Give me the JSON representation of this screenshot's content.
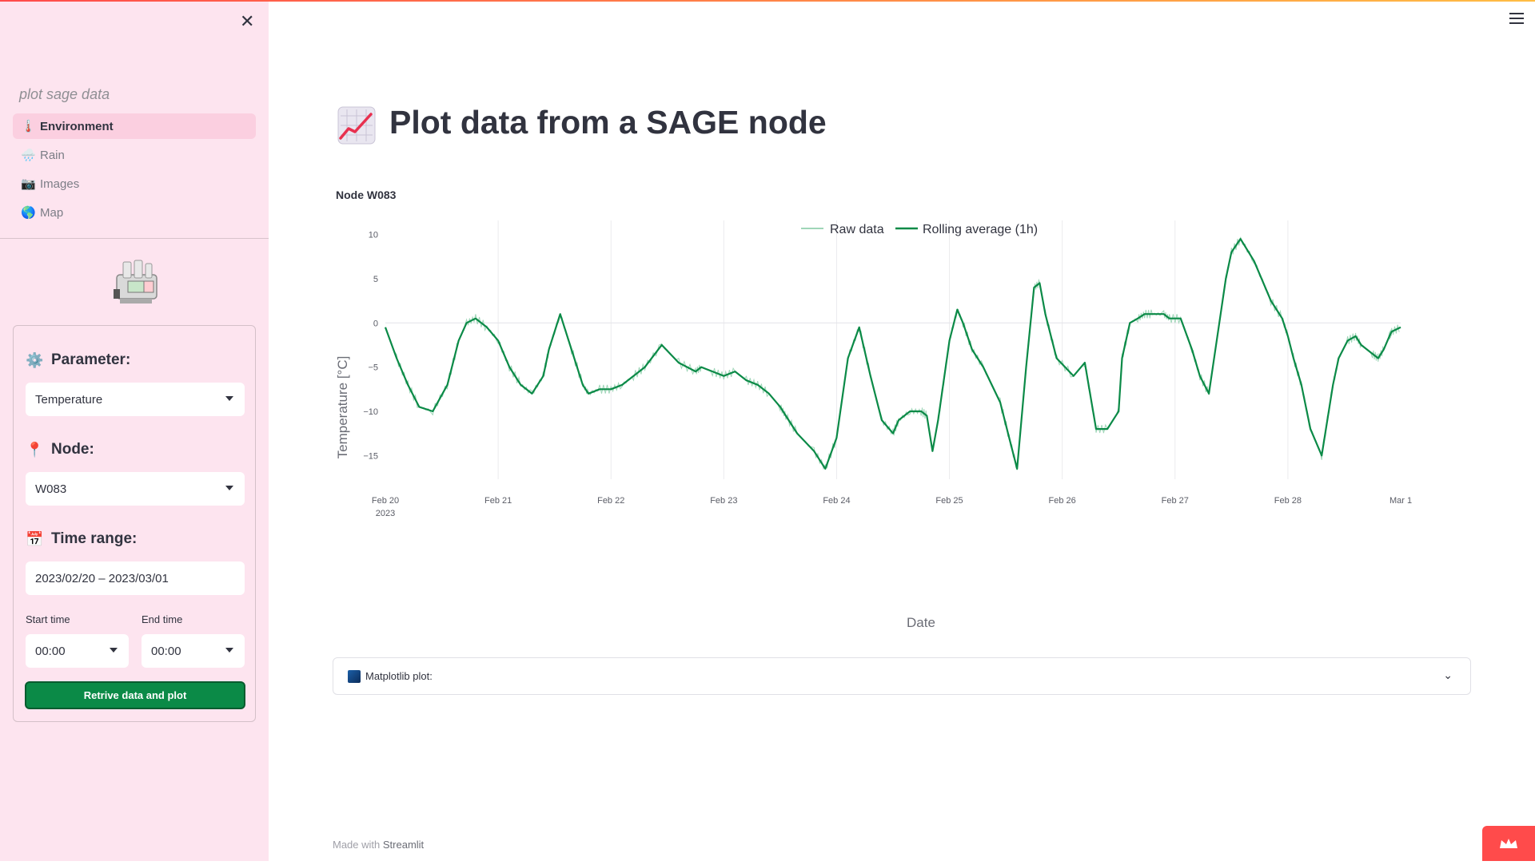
{
  "sidebar": {
    "app_name": "plot sage data",
    "nav": [
      {
        "label": "Environment",
        "icon": "thermometer-icon",
        "active": true
      },
      {
        "label": "Rain",
        "icon": "rain-cloud-icon",
        "active": false
      },
      {
        "label": "Images",
        "icon": "camera-icon",
        "active": false
      },
      {
        "label": "Map",
        "icon": "globe-icon",
        "active": false
      }
    ],
    "parameter": {
      "label": "Parameter:",
      "value": "Temperature"
    },
    "node": {
      "label": "Node:",
      "value": "W083"
    },
    "time_range": {
      "label": "Time range:",
      "value": "2023/02/20 – 2023/03/01"
    },
    "start_time": {
      "label": "Start time",
      "value": "00:00"
    },
    "end_time": {
      "label": "End time",
      "value": "00:00"
    },
    "button_label": "Retrive data and plot"
  },
  "main": {
    "title": "Plot data from a SAGE node",
    "subheader": "Node W083",
    "expander_label": "Matplotlib plot:"
  },
  "footer": {
    "prefix": "Made with",
    "brand": "Streamlit"
  },
  "colors": {
    "accent": "#0b8a47",
    "sidebar_bg": "#fde4ef",
    "raw_line": "#9fd6b8",
    "avg_line": "#0b8a47"
  },
  "chart_data": {
    "type": "line",
    "xlabel": "Date",
    "ylabel": "Temperature [°C]",
    "ylim": [
      -17.5,
      10.5
    ],
    "yticks": [
      10,
      5,
      0,
      -5,
      -10,
      -15
    ],
    "ytick_labels": [
      "10",
      "5",
      "0",
      "−5",
      "−10",
      "−15"
    ],
    "xticks": [
      0,
      1,
      2,
      3,
      4,
      5,
      6,
      7,
      8,
      9
    ],
    "xtick_labels": [
      "Feb 20",
      "Feb 21",
      "Feb 22",
      "Feb 23",
      "Feb 24",
      "Feb 25",
      "Feb 26",
      "Feb 27",
      "Feb 28",
      "Mar 1"
    ],
    "xtick_sublabel": "2023",
    "legend_position": "top-center",
    "grid": true,
    "series": [
      {
        "name": "Raw data",
        "color": "#9fd6b8"
      },
      {
        "name": "Rolling average (1h)",
        "color": "#0b8a47",
        "x": [
          0,
          0.1,
          0.2,
          0.3,
          0.42,
          0.55,
          0.65,
          0.72,
          0.8,
          0.9,
          1.0,
          1.1,
          1.2,
          1.3,
          1.4,
          1.45,
          1.55,
          1.65,
          1.75,
          1.8,
          1.9,
          2.0,
          2.1,
          2.2,
          2.3,
          2.45,
          2.6,
          2.75,
          2.8,
          2.9,
          3.0,
          3.1,
          3.2,
          3.3,
          3.4,
          3.5,
          3.55,
          3.65,
          3.8,
          3.9,
          4.0,
          4.1,
          4.2,
          4.3,
          4.4,
          4.5,
          4.55,
          4.65,
          4.75,
          4.8,
          4.85,
          4.9,
          5.0,
          5.07,
          5.12,
          5.2,
          5.3,
          5.45,
          5.53,
          5.6,
          5.68,
          5.75,
          5.8,
          5.85,
          5.95,
          6.1,
          6.2,
          6.3,
          6.4,
          6.5,
          6.53,
          6.6,
          6.67,
          6.73,
          6.8,
          6.9,
          6.95,
          7.05,
          7.15,
          7.22,
          7.3,
          7.45,
          7.5,
          7.58,
          7.7,
          7.85,
          7.95,
          8.0,
          8.05,
          8.12,
          8.2,
          8.3,
          8.4,
          8.45,
          8.53,
          8.6,
          8.65,
          8.75,
          8.8,
          8.85,
          8.9,
          8.92,
          9.0
        ],
        "y": [
          -0.5,
          -4,
          -7,
          -9.5,
          -10,
          -7,
          -2,
          0,
          0.5,
          -0.5,
          -2,
          -5,
          -7,
          -8,
          -6,
          -3,
          1,
          -3,
          -7,
          -8,
          -7.5,
          -7.5,
          -7,
          -6,
          -5,
          -2.5,
          -4.5,
          -5.5,
          -5,
          -5.5,
          -6,
          -5.5,
          -6.5,
          -7,
          -8,
          -9.5,
          -10.5,
          -12.5,
          -14.5,
          -16.5,
          -13,
          -4,
          -0.5,
          -6,
          -11,
          -12.5,
          -11,
          -10,
          -10,
          -10.5,
          -14.5,
          -11,
          -2,
          1.5,
          0,
          -3,
          -5,
          -9,
          -13,
          -16.5,
          -5,
          4,
          4.5,
          1,
          -4,
          -6,
          -4.5,
          -12,
          -12,
          -10,
          -4,
          0,
          0.5,
          1,
          1,
          1,
          0.5,
          0.5,
          -3,
          -6,
          -8,
          5,
          8,
          9.5,
          7,
          2.5,
          0.5,
          -1.5,
          -4,
          -7,
          -12,
          -15,
          -7,
          -4,
          -2,
          -1.5,
          -2.5,
          -3.5,
          -4,
          -3,
          -1.5,
          -1,
          -0.5
        ]
      }
    ]
  }
}
